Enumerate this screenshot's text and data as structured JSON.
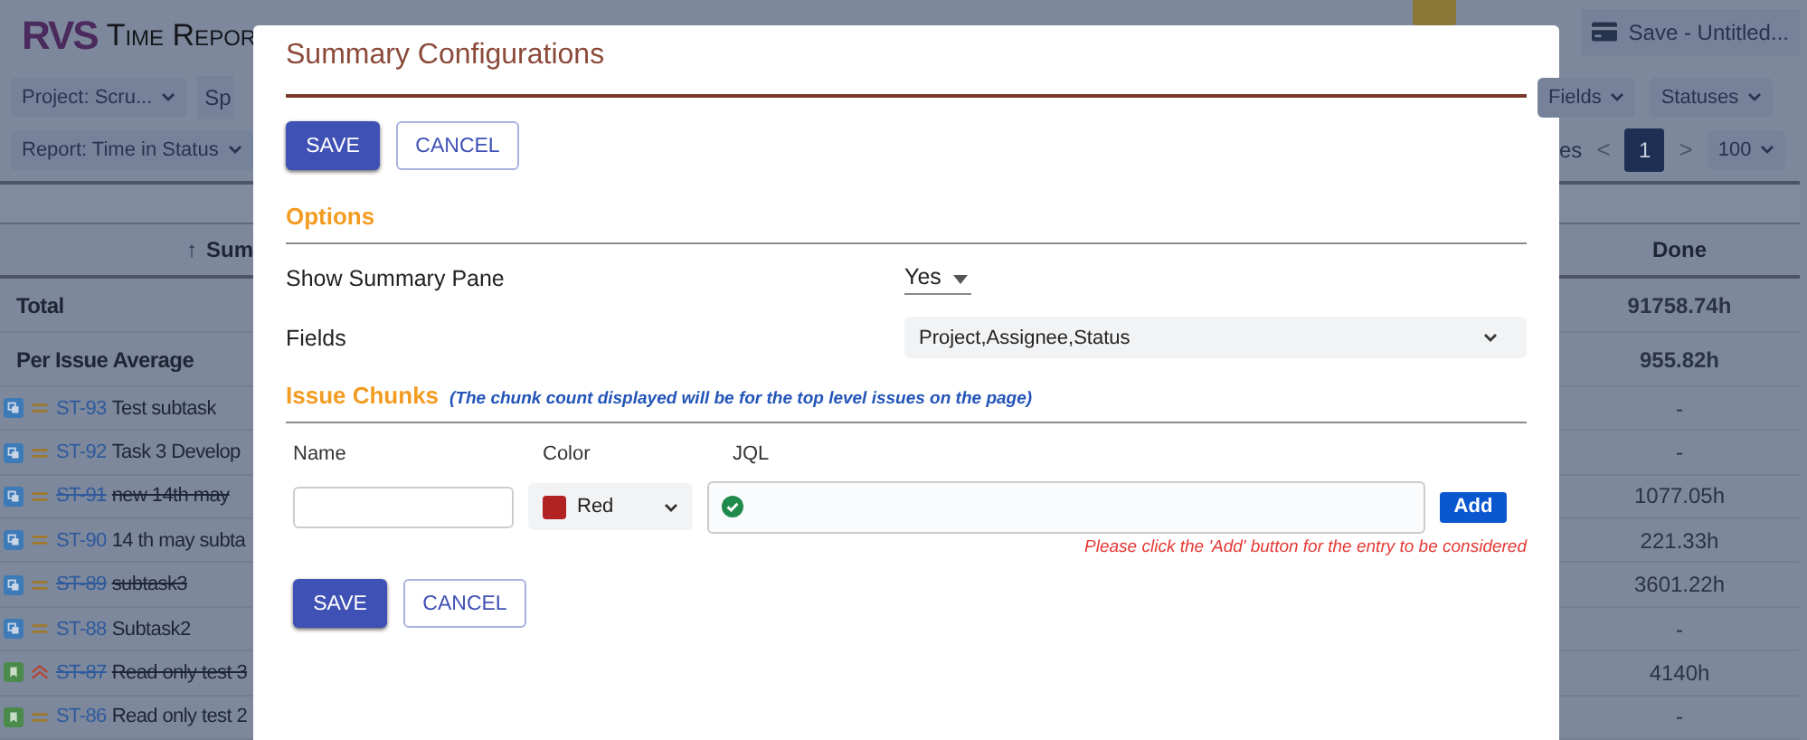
{
  "app": {
    "logo": "RVS",
    "title": "Time Repor",
    "save_menu": "Save - Untitled..."
  },
  "toolbar": {
    "project": "Project: Scru...",
    "sprint_fragment": "Sp",
    "fields": "Fields",
    "statuses": "Statuses",
    "report": "Report: Time in Status",
    "pages_fragment": "es",
    "prev": "<",
    "page": "1",
    "next": ">",
    "page_size": "100"
  },
  "table": {
    "summary_header": "Sum",
    "sort_arrow": "↑",
    "done_header": "Done",
    "totals": [
      {
        "label": "Total",
        "done": "91758.74h"
      },
      {
        "label": "Per Issue Average",
        "done": "955.82h"
      }
    ],
    "rows": [
      {
        "kind": "subtask",
        "priority": {
          "kind": "medium"
        },
        "key": "ST-93",
        "summary": "Test subtask",
        "done": "-",
        "struck": false
      },
      {
        "kind": "subtask",
        "priority": {
          "kind": "medium"
        },
        "key": "ST-92",
        "summary": "Task 3 Develop",
        "done": "-",
        "struck": false
      },
      {
        "kind": "subtask",
        "priority": {
          "kind": "medium"
        },
        "key": "ST-91",
        "summary": "new 14th may",
        "done": "1077.05h",
        "struck": true
      },
      {
        "kind": "subtask",
        "priority": {
          "kind": "medium"
        },
        "key": "ST-90",
        "summary": "14 th may subta",
        "done": "221.33h",
        "struck": false
      },
      {
        "kind": "subtask",
        "priority": {
          "kind": "medium"
        },
        "key": "ST-89",
        "summary": "subtask3",
        "done": "3601.22h",
        "struck": true
      },
      {
        "kind": "subtask",
        "priority": {
          "kind": "medium"
        },
        "key": "ST-88",
        "summary": "Subtask2",
        "done": "-",
        "struck": false
      },
      {
        "kind": "story",
        "priority": {
          "kind": "high"
        },
        "key": "ST-87",
        "summary": "Read only test 3",
        "done": "4140h",
        "struck": true
      },
      {
        "kind": "story",
        "priority": {
          "kind": "medium"
        },
        "key": "ST-86",
        "summary": "Read only test 2",
        "done": "-",
        "struck": false
      }
    ]
  },
  "dialog": {
    "title": "Summary Configurations",
    "top_buttons": {
      "save": "SAVE",
      "cancel": "CANCEL"
    },
    "bottom_buttons": {
      "save": "SAVE",
      "cancel": "CANCEL"
    },
    "options": {
      "heading": "Options",
      "show_summary_label": "Show Summary Pane",
      "show_summary_value": "Yes",
      "fields_label": "Fields",
      "fields_value": "Project,Assignee,Status"
    },
    "chunks": {
      "heading": "Issue Chunks",
      "note": "(The chunk count displayed will be for the top level issues on the page)",
      "name_label": "Name",
      "color_label": "Color",
      "jql_label": "JQL",
      "color_value": "Red",
      "color": "#b22222",
      "add": "Add",
      "hint": "Please click the 'Add' button for the entry to be considered"
    }
  }
}
